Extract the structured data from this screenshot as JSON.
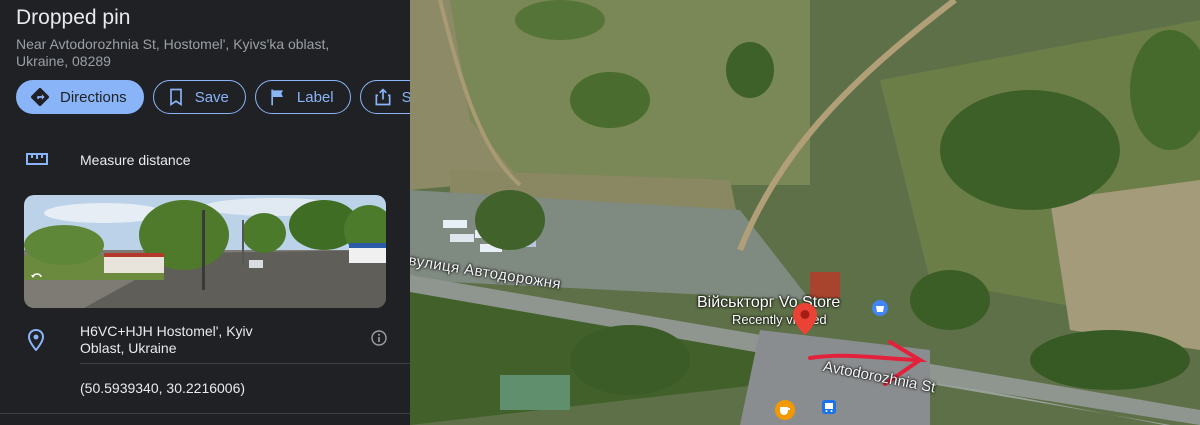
{
  "place": {
    "title": "Dropped pin",
    "subtitle": "Near Avtodorozhnia St, Hostomel', Kyivs'ka oblast, Ukraine, 08289"
  },
  "actions": {
    "directions": "Directions",
    "save": "Save",
    "label": "Label",
    "share": "S"
  },
  "measure": {
    "label": "Measure distance"
  },
  "plus_code": {
    "line1": "H6VC+HJH Hostomel', Kyiv",
    "line2": "Oblast, Ukraine"
  },
  "coordinates": "(50.5939340, 30.2216006)",
  "map": {
    "road_label_uk": "вулиця Автодорожня",
    "road_label_en": "Avtodorozhnia St",
    "store_name": "Військторг Vo  Store",
    "store_sub": "Recently viewed"
  },
  "colors": {
    "accent": "#8ab4f8",
    "panel_bg": "#202124",
    "pin": "#ea4335"
  }
}
